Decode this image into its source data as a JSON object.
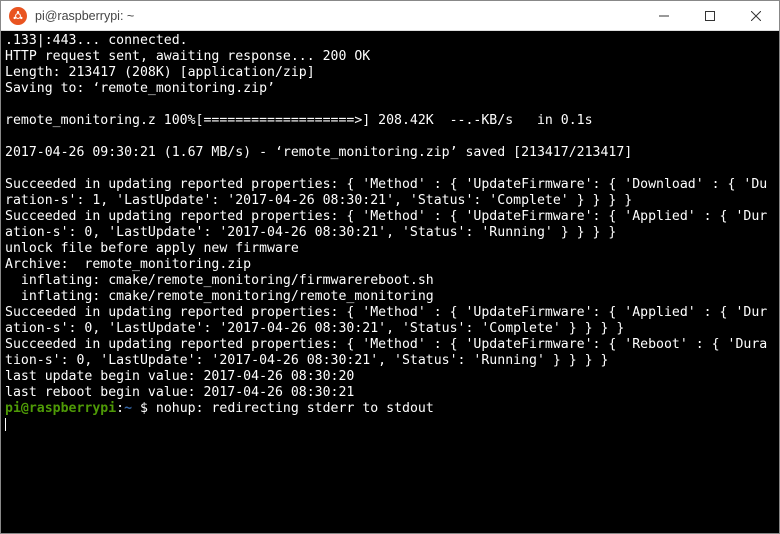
{
  "titlebar": {
    "title": "pi@raspberrypi: ~"
  },
  "term": {
    "block": ".133|:443... connected.\nHTTP request sent, awaiting response... 200 OK\nLength: 213417 (208K) [application/zip]\nSaving to: ‘remote_monitoring.zip’\n\nremote_monitoring.z 100%[===================>] 208.42K  --.-KB/s   in 0.1s\n\n2017-04-26 09:30:21 (1.67 MB/s) - ‘remote_monitoring.zip’ saved [213417/213417]\n\nSucceeded in updating reported properties: { 'Method' : { 'UpdateFirmware': { 'Download' : { 'Duration-s': 1, 'LastUpdate': '2017-04-26 08:30:21', 'Status': 'Complete' } } } }\nSucceeded in updating reported properties: { 'Method' : { 'UpdateFirmware': { 'Applied' : { 'Duration-s': 0, 'LastUpdate': '2017-04-26 08:30:21', 'Status': 'Running' } } } }\nunlock file before apply new firmware\nArchive:  remote_monitoring.zip\n  inflating: cmake/remote_monitoring/firmwarereboot.sh\n  inflating: cmake/remote_monitoring/remote_monitoring\nSucceeded in updating reported properties: { 'Method' : { 'UpdateFirmware': { 'Applied' : { 'Duration-s': 0, 'LastUpdate': '2017-04-26 08:30:21', 'Status': 'Complete' } } } }\nSucceeded in updating reported properties: { 'Method' : { 'UpdateFirmware': { 'Reboot' : { 'Duration-s': 0, 'LastUpdate': '2017-04-26 08:30:21', 'Status': 'Running' } } } }\nlast update begin value: 2017-04-26 08:30:20\nlast reboot begin value: 2017-04-26 08:30:21",
    "prompt_user_host": "pi@raspberrypi",
    "prompt_colon": ":",
    "prompt_tilde": "~",
    "prompt_dollar": " $ ",
    "after_prompt": "nohup: redirecting stderr to stdout"
  }
}
